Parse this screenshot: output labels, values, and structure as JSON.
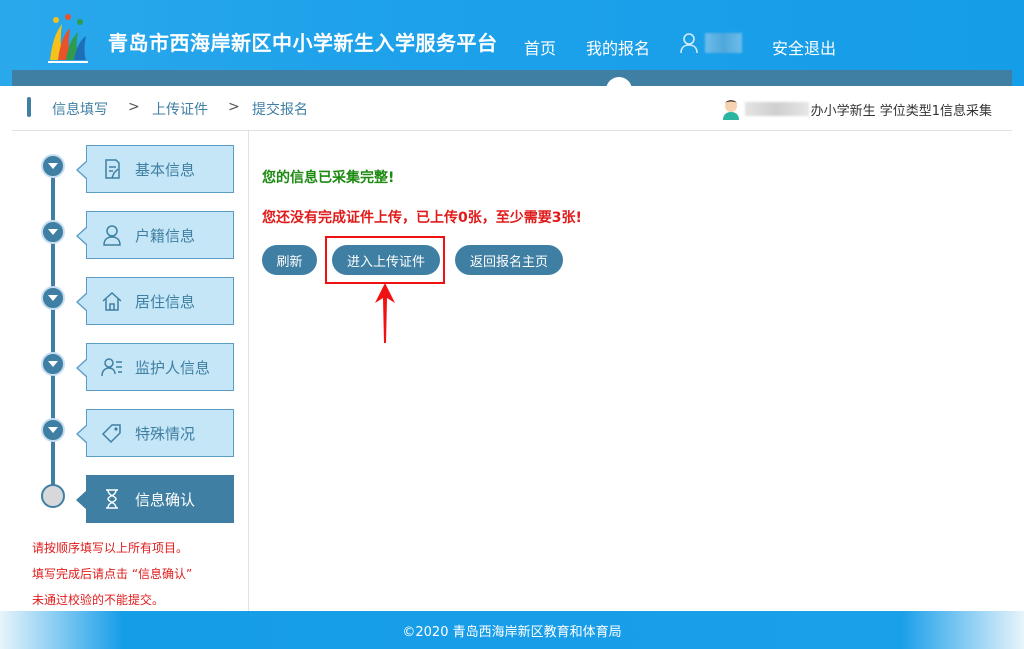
{
  "header": {
    "site_title": "青岛市西海岸新区中小学新生入学服务平台",
    "nav": {
      "home": "首页",
      "my_registration": "我的报名",
      "logout": "安全退出"
    }
  },
  "breadcrumb": {
    "items": [
      "信息填写",
      "上传证件",
      "提交报名"
    ],
    "separator": ">",
    "right_info": "办小学新生 学位类型1信息采集"
  },
  "sidebar": {
    "steps": [
      {
        "label": "基本信息",
        "icon": "document-edit-icon"
      },
      {
        "label": "户籍信息",
        "icon": "person-icon"
      },
      {
        "label": "居住信息",
        "icon": "home-icon"
      },
      {
        "label": "监护人信息",
        "icon": "guardian-list-icon"
      },
      {
        "label": "特殊情况",
        "icon": "tag-icon"
      },
      {
        "label": "信息确认",
        "icon": "hourglass-icon"
      }
    ],
    "notes": [
      "请按顺序填写以上所有项目。",
      "填写完成后请点击 “信息确认”",
      "未通过校验的不能提交。"
    ]
  },
  "content": {
    "message_ok": "您的信息已采集完整!",
    "message_warn": "您还没有完成证件上传，已上传0张，至少需要3张!",
    "buttons": {
      "refresh": "刷新",
      "upload": "进入上传证件",
      "back": "返回报名主页"
    }
  },
  "footer": {
    "copyright": "©2020 青岛西海岸新区教育和体育局"
  },
  "colors": {
    "header_blue": "#1da1ea",
    "accent": "#3f7fa3",
    "step_bg": "#c5e6f7",
    "ok_green": "#1d8a12",
    "warn_red": "#e01b1b"
  }
}
